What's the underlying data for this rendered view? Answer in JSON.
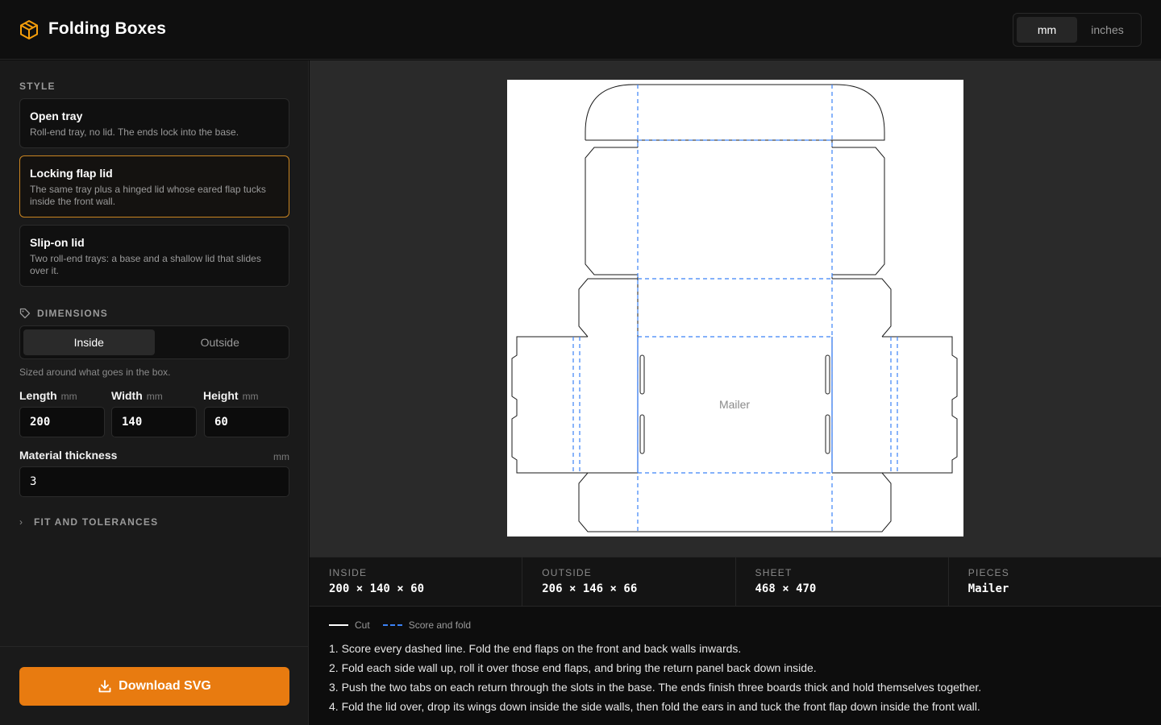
{
  "app": {
    "title": "Folding Boxes"
  },
  "units": {
    "options": [
      "mm",
      "inches"
    ],
    "selected": "mm"
  },
  "sidebar": {
    "style_label": "STYLE",
    "styles": [
      {
        "title": "Open tray",
        "description": "Roll-end tray, no lid. The ends lock into the base.",
        "selected": false
      },
      {
        "title": "Locking flap lid",
        "description": "The same tray plus a hinged lid whose eared flap tucks inside the front wall.",
        "selected": true
      },
      {
        "title": "Slip-on lid",
        "description": "Two roll-end trays: a base and a shallow lid that slides over it.",
        "selected": false
      }
    ],
    "dimensions_label": "DIMENSIONS",
    "measure_toggle": {
      "options": [
        "Inside",
        "Outside"
      ],
      "selected": "Inside"
    },
    "hint": "Sized around what goes in the box.",
    "fields": {
      "length": {
        "label": "Length",
        "unit": "mm",
        "value": "200"
      },
      "width": {
        "label": "Width",
        "unit": "mm",
        "value": "140"
      },
      "height": {
        "label": "Height",
        "unit": "mm",
        "value": "60"
      },
      "thickness": {
        "label": "Material thickness",
        "unit": "mm",
        "value": "3"
      }
    },
    "fit_label": "FIT AND TOLERANCES",
    "download_label": "Download SVG"
  },
  "canvas": {
    "piece_label": "Mailer"
  },
  "colors": {
    "accent": "#e87b10",
    "selected_border": "#c98521",
    "score_line": "#3b82f6",
    "cut_line": "#1a1a1a"
  },
  "stats": [
    {
      "key": "INSIDE",
      "value": "200 × 140 × 60"
    },
    {
      "key": "OUTSIDE",
      "value": "206 × 146 × 66"
    },
    {
      "key": "SHEET",
      "value": "468 × 470"
    },
    {
      "key": "PIECES",
      "value": "Mailer"
    }
  ],
  "legend": {
    "cut": "Cut",
    "score": "Score and fold"
  },
  "steps": [
    "1. Score every dashed line. Fold the end flaps on the front and back walls inwards.",
    "2. Fold each side wall up, roll it over those end flaps, and bring the return panel back down inside.",
    "3. Push the two tabs on each return through the slots in the base. The ends finish three boards thick and hold themselves together.",
    "4. Fold the lid over, drop its wings down inside the side walls, then fold the ears in and tuck the front flap down inside the front wall."
  ]
}
